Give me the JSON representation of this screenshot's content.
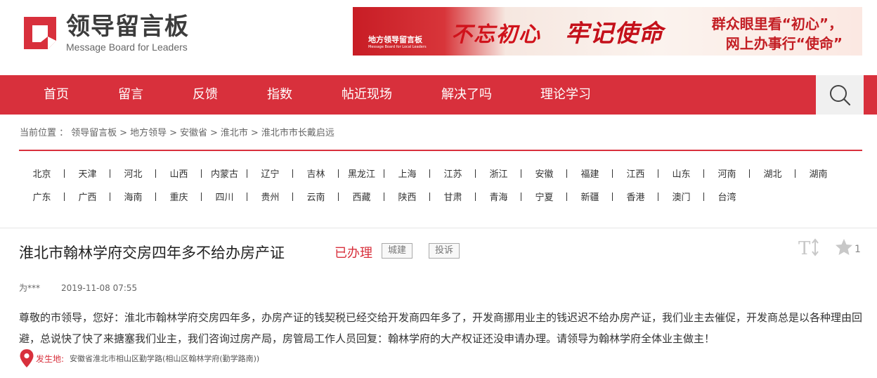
{
  "header": {
    "logo_title": "领导留言板",
    "logo_subtitle": "Message Board for Leaders"
  },
  "banner": {
    "brand": "地方领导留言板",
    "brand_en": "Message Board for Local Leaders",
    "slogan_1": "不忘初心",
    "slogan_2": "牢记使命",
    "line_1": "群众眼里看“初心”，",
    "line_2": "网上办事行“使命”"
  },
  "nav": {
    "items": [
      "首页",
      "留言",
      "反馈",
      "指数",
      "帖近现场",
      "解决了吗",
      "理论学习"
    ],
    "search_icon": "search-icon"
  },
  "breadcrumb": {
    "prefix": "当前位置 ：",
    "items": [
      "领导留言板",
      "地方领导",
      "安徽省",
      "淮北市",
      "淮北市市长戴启远"
    ],
    "separator": ">"
  },
  "provinces": {
    "row1": [
      "北京",
      "天津",
      "河北",
      "山西",
      "内蒙古",
      "辽宁",
      "吉林",
      "黑龙江",
      "上海",
      "江苏",
      "浙江",
      "安徽",
      "福建",
      "江西",
      "山东",
      "河南",
      "湖北",
      "湖南"
    ],
    "row2": [
      "广东",
      "广西",
      "海南",
      "重庆",
      "四川",
      "贵州",
      "云南",
      "西藏",
      "陕西",
      "甘肃",
      "青海",
      "宁夏",
      "新疆",
      "香港",
      "澳门",
      "台湾"
    ]
  },
  "article": {
    "title": "淮北市翰林学府交房四年多不给办房产证",
    "status": "已办理",
    "tag_category": "城建",
    "tag_type": "投诉",
    "star_count": "1",
    "author": "为***",
    "date": "2019-11-08 07:55",
    "body": "尊敬的市领导，您好：淮北市翰林学府交房四年多，办房产证的钱契税已经交给开发商四年多了，开发商挪用业主的钱迟迟不给办房产证，我们业主去催促，开发商总是以各种理由回避，总说快了快了来搪塞我们业主，我们咨询过房产局，房管局工作人员回复：翰林学府的大产权证还没申请办理。请领导为翰林学府全体业主做主！",
    "location_label": "发生地:",
    "location": "安徽省淮北市相山区勤学路(相山区翰林学府(勤学路南))"
  },
  "colors": {
    "brand_red": "#d8303c"
  }
}
